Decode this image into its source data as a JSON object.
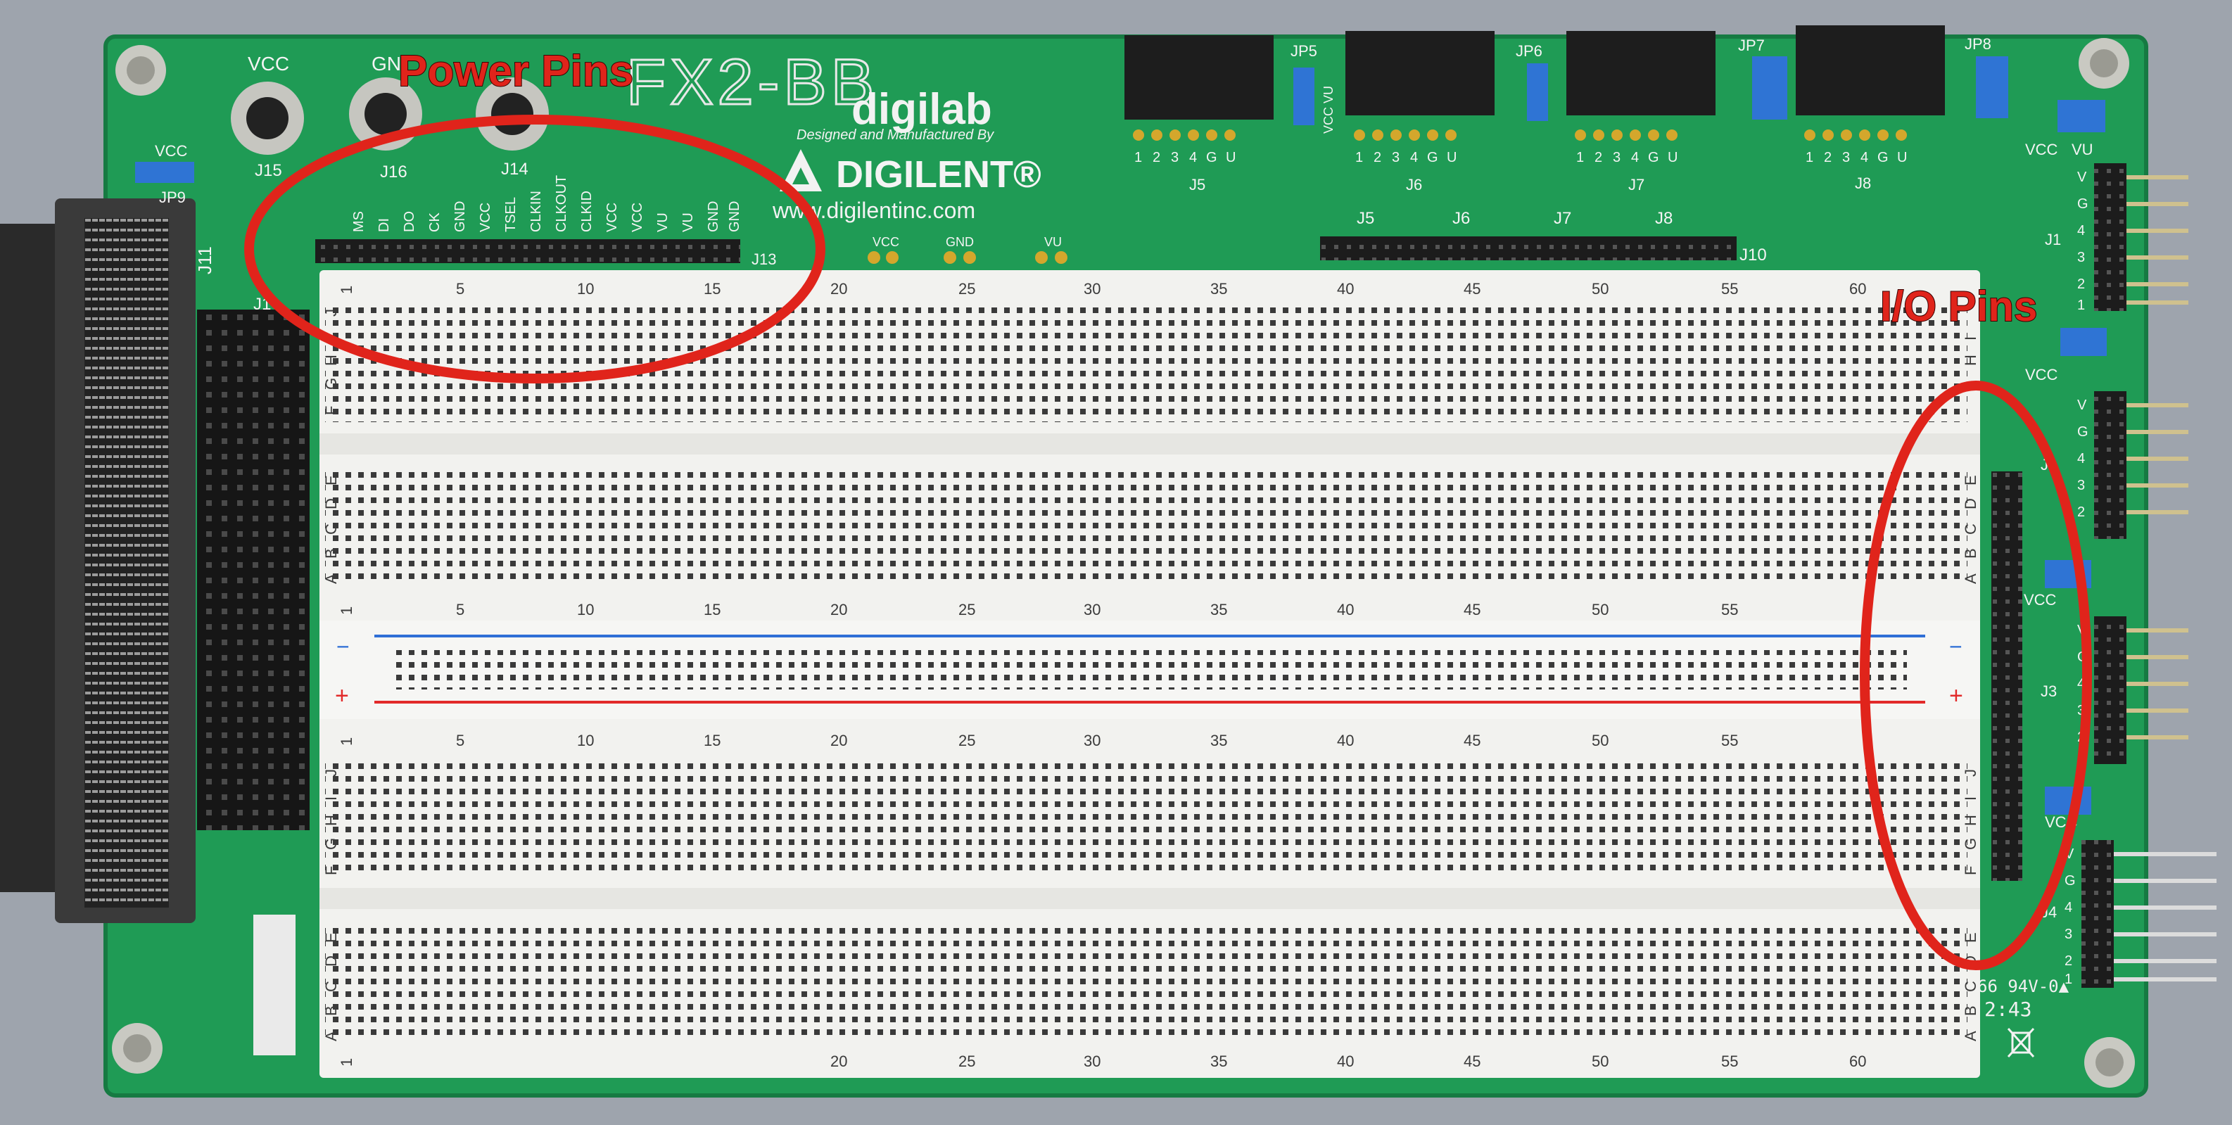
{
  "board": {
    "name_partial": "FX2-BB",
    "brand": "digilab",
    "manufacturer_line": "Designed and Manufactured By",
    "company": "DIGILENT®",
    "website": "www.digilentinc.com",
    "cert_mark": "66 94V-0▲",
    "date_code": "2:43"
  },
  "annotations": {
    "power_label": "Power Pins",
    "io_label": "I/O Pins",
    "annotation_color": "#e0241b"
  },
  "labels": {
    "vcc_jack": "VCC",
    "gnd_jack": "GN",
    "j15": "J15",
    "j16": "J16",
    "j14": "J14",
    "vcc_jp9": "VCC",
    "jp9": "JP9",
    "j11": "J11",
    "j1_left": "J1",
    "j13": "J13",
    "pad_vcc": "VCC",
    "pad_gnd": "GND",
    "pad_vu": "VU",
    "j13_pins": [
      "MS",
      "DI",
      "DO",
      "CK",
      "GND",
      "VCC",
      "TSEL",
      "CLKIN",
      "CLKOUT",
      "CLKID",
      "VCC",
      "VCC",
      "VU",
      "VU",
      "GND",
      "GND"
    ],
    "top_headers": [
      {
        "jp": "JP5",
        "j": "J5"
      },
      {
        "jp": "JP6",
        "j": "J6"
      },
      {
        "jp": "JP7",
        "j": "J7"
      },
      {
        "jp": "JP8",
        "j": "J8"
      }
    ],
    "header_pins": [
      "1",
      "2",
      "3",
      "4",
      "G",
      "U"
    ],
    "jp_side": "VCC VU",
    "top_strip": [
      "J5",
      "J6",
      "J7",
      "J8",
      "J10"
    ],
    "right_vcc": "VCC",
    "right_vu": "VU",
    "right_headers": [
      "J1",
      "J2",
      "J3",
      "J4"
    ],
    "right_pins": [
      "V",
      "G",
      "4",
      "3",
      "2",
      "1"
    ]
  },
  "breadboard": {
    "numbers": [
      "1",
      "5",
      "10",
      "15",
      "20",
      "25",
      "30",
      "35",
      "40",
      "45",
      "50",
      "55",
      "60"
    ],
    "rows_top_a": [
      "J",
      "I",
      "H",
      "G",
      "F"
    ],
    "rows_top_b": [
      "E",
      "D",
      "C",
      "B",
      "A"
    ],
    "rows_bot_a": [
      "J",
      "I",
      "H",
      "G",
      "F"
    ],
    "rows_bot_b": [
      "E",
      "D",
      "C",
      "B",
      "A"
    ],
    "rail_minus": "−",
    "rail_plus": "+",
    "rail_minus_color": "#2f6fd6",
    "rail_plus_color": "#e22a2a"
  },
  "colors": {
    "pcb": "#1e9a54",
    "breadboard": "#f3f3f1",
    "header_black": "#1c1c1c",
    "jumper_blue": "#2a6fd0"
  }
}
